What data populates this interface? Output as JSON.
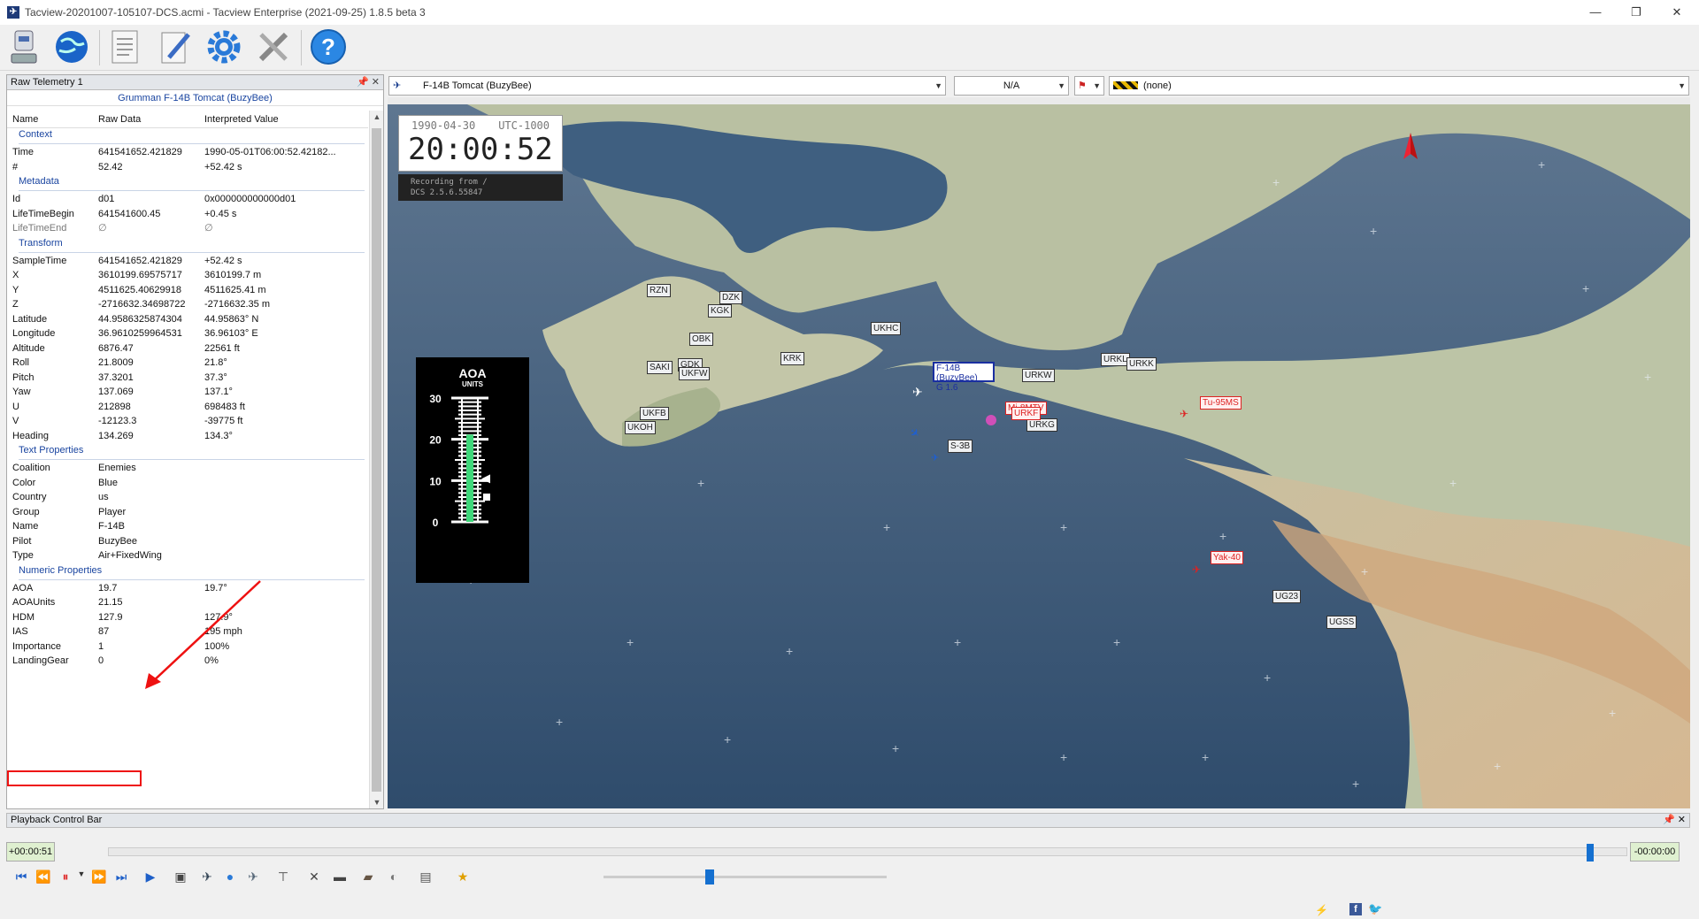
{
  "window": {
    "title": "Tacview-20201007-105107-DCS.acmi - Tacview Enterprise (2021-09-25) 1.8.5 beta 3",
    "minimize": "—",
    "restore": "❐",
    "close": "✕"
  },
  "toolbar": [
    "record-icon",
    "globe-icon",
    "document-icon",
    "edit-icon",
    "settings-icon",
    "tools-icon",
    "help-icon"
  ],
  "telemetry": {
    "panel_title": "Raw Telemetry 1",
    "object_title": "Grumman F-14B Tomcat (BuzyBee)",
    "columns": [
      "Name",
      "Raw Data",
      "Interpreted Value"
    ],
    "sections": [
      {
        "title": "Context",
        "rows": [
          [
            "Time",
            "641541652.421829",
            "1990-05-01T06:00:52.42182..."
          ],
          [
            "#",
            "52.42",
            "+52.42 s"
          ]
        ]
      },
      {
        "title": "Metadata",
        "rows": [
          [
            "Id",
            "d01",
            "0x000000000000d01"
          ],
          [
            "LifeTimeBegin",
            "641541600.45",
            "+0.45 s"
          ],
          [
            "LifeTimeEnd",
            "∅",
            "∅"
          ]
        ]
      },
      {
        "title": "Transform",
        "rows": [
          [
            "SampleTime",
            "641541652.421829",
            "+52.42 s"
          ],
          [
            "X",
            "3610199.69575717",
            "3610199.7 m"
          ],
          [
            "Y",
            "4511625.40629918",
            "4511625.41 m"
          ],
          [
            "Z",
            "-2716632.34698722",
            "-2716632.35 m"
          ],
          [
            "Latitude",
            "44.9586325874304",
            "44.95863° N"
          ],
          [
            "Longitude",
            "36.9610259964531",
            "36.96103° E"
          ],
          [
            "Altitude",
            "6876.47",
            "22561 ft"
          ],
          [
            "Roll",
            "21.8009",
            "21.8°"
          ],
          [
            "Pitch",
            "37.3201",
            "37.3°"
          ],
          [
            "Yaw",
            "137.069",
            "137.1°"
          ],
          [
            "U",
            "212898",
            "698483 ft"
          ],
          [
            "V",
            "-12123.3",
            "-39775 ft"
          ],
          [
            "Heading",
            "134.269",
            "134.3°"
          ]
        ]
      },
      {
        "title": "Text Properties",
        "rows": [
          [
            "Coalition",
            "Enemies",
            ""
          ],
          [
            "Color",
            "Blue",
            ""
          ],
          [
            "Country",
            "us",
            ""
          ],
          [
            "Group",
            "Player",
            ""
          ],
          [
            "Name",
            "F-14B",
            ""
          ],
          [
            "Pilot",
            "BuzyBee",
            ""
          ],
          [
            "Type",
            "Air+FixedWing",
            ""
          ]
        ]
      },
      {
        "title": "Numeric Properties",
        "rows": [
          [
            "AOA",
            "19.7",
            "19.7°"
          ],
          [
            "AOAUnits",
            "21.15",
            ""
          ],
          [
            "HDM",
            "127.9",
            "127.9°"
          ],
          [
            "IAS",
            "87",
            "195 mph"
          ],
          [
            "Importance",
            "1",
            "100%"
          ],
          [
            "LandingGear",
            "0",
            "0%"
          ]
        ]
      }
    ]
  },
  "view": {
    "object_select": "F-14B Tomcat (BuzyBee)",
    "target_select": "N/A",
    "camo_select": "(none)",
    "clock_date": "1990-04-30",
    "clock_tz": "UTC-1000",
    "clock_time": "20:00:52",
    "rec_line1": "Recording from /",
    "rec_line2": "DCS 2.5.6.55847",
    "aoa_title": "AOA",
    "aoa_sub": "UNITS",
    "aoa_ticks": [
      "30",
      "20",
      "10",
      "0"
    ],
    "aoa_value": 21.15,
    "airfields": [
      [
        "RZN",
        293,
        203
      ],
      [
        "DZK",
        375,
        211
      ],
      [
        "KGK",
        362,
        226
      ],
      [
        "OBK",
        341,
        258
      ],
      [
        "UKHC",
        546,
        246
      ],
      [
        "KRK",
        444,
        280
      ],
      [
        "SAKI",
        293,
        290
      ],
      [
        "GDK",
        328,
        287
      ],
      [
        "UKFW",
        329,
        297
      ],
      [
        "UKFB",
        285,
        342
      ],
      [
        "UKOH",
        268,
        358
      ],
      [
        "URKW",
        717,
        299
      ],
      [
        "URKL",
        806,
        281
      ],
      [
        "URKK",
        835,
        286
      ],
      [
        "URKG",
        722,
        355
      ],
      [
        "UG23",
        1000,
        549
      ],
      [
        "UGSS",
        1061,
        578
      ]
    ],
    "units_red": [
      [
        "Mi-8MTV",
        698,
        336
      ],
      [
        "Tu-95MS",
        918,
        330
      ],
      [
        "Yak-40",
        930,
        505
      ],
      [
        "URKF",
        705,
        342
      ]
    ],
    "units_blue": [
      [
        "S-3B",
        633,
        379
      ]
    ],
    "player_label_1": "F-14B (BuzyBee)",
    "player_label_2": "G 1.6"
  },
  "playback": {
    "title": "Playback Control Bar",
    "time_left": "+00:00:51",
    "time_right": "-00:00:00",
    "position": 0.975,
    "speed": 0.36,
    "controls": [
      "skip-start-icon",
      "rewind-icon",
      "pause-icon",
      "fast-forward-icon",
      "skip-end-icon",
      "step-icon"
    ]
  }
}
